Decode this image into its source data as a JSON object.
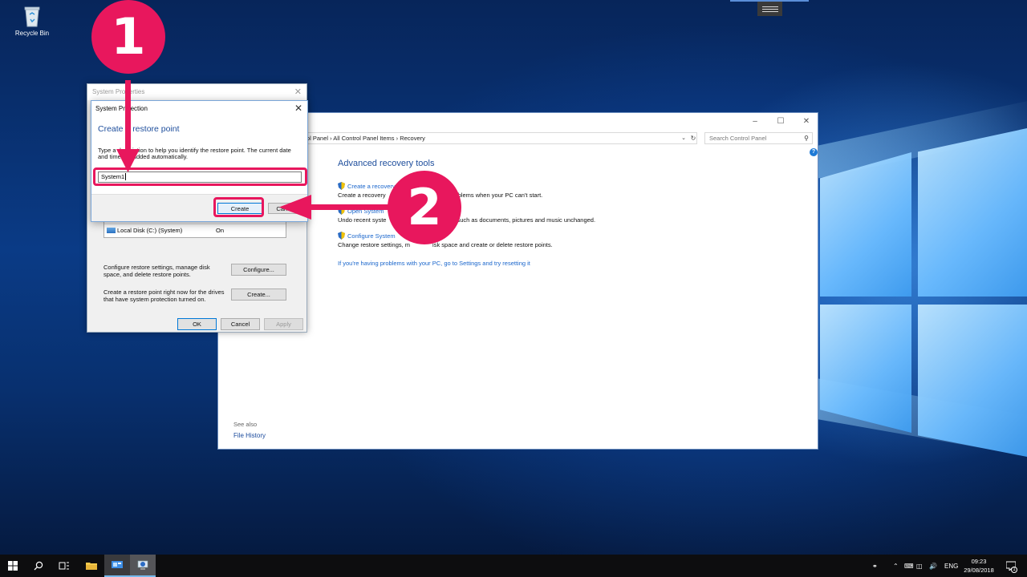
{
  "desktop": {
    "recycle_bin_label": "Recycle Bin"
  },
  "recovery_window": {
    "address_path": "ontrol Panel  ›  All Control Panel Items  ›  Recovery",
    "search_placeholder": "Search Control Panel",
    "heading": "Advanced recovery tools",
    "tools": [
      {
        "link": "Create a recovery",
        "desc": "Create a recovery",
        "desc_tail": "blems when your PC can't start."
      },
      {
        "link": "Open System",
        "desc": "Undo recent syste",
        "desc_tail": "such as documents, pictures and music unchanged."
      },
      {
        "link": "Configure System",
        "desc": "Change restore settings, m",
        "desc_tail": "isk space and create or delete restore points."
      }
    ],
    "reset_link": "If you're having problems with your PC, go to Settings and try resetting it",
    "see_also": "See also",
    "file_history": "File History"
  },
  "system_properties": {
    "title": "System Properties",
    "drives_header_left": "Available Drives",
    "drives_header_right": "Protection",
    "drive_name": "Local Disk (C:) (System)",
    "drive_status": "On",
    "configure_text": "Configure restore settings, manage disk space, and delete restore points.",
    "configure_button": "Configure...",
    "create_text": "Create a restore point right now for the drives that have system protection turned on.",
    "create_button": "Create...",
    "ok": "OK",
    "cancel": "Cancel",
    "apply": "Apply"
  },
  "system_protection": {
    "title": "System Protection",
    "heading": "Create a restore point",
    "description": "Type a description to help you identify the restore point. The current date and time are added automatically.",
    "input_value": "System1",
    "create_button": "Create",
    "cancel_button": "Cancel"
  },
  "annotations": {
    "step1": "1",
    "step2": "2",
    "color": "#e8175d"
  },
  "taskbar": {
    "language": "ENG",
    "time": "09:23",
    "date": "29/08/2018",
    "notification_count": "1"
  }
}
